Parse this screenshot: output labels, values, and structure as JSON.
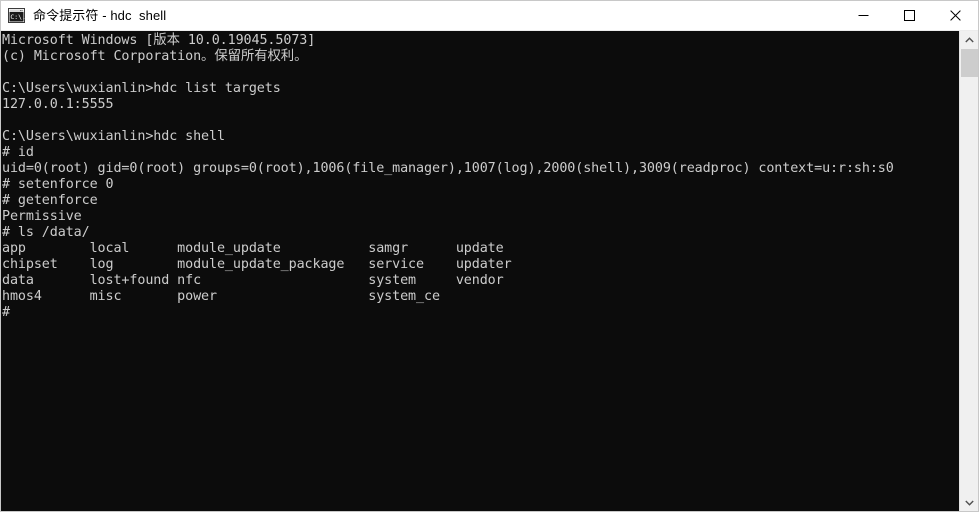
{
  "window": {
    "title": "命令提示符 - hdc  shell",
    "icon": "cmd-console-icon",
    "colors": {
      "titlebar_bg": "#ffffff",
      "titlebar_fg": "#000000",
      "console_bg": "#0c0c0c",
      "console_fg": "#cccccc",
      "scrollbar_track": "#f0f0f0",
      "scrollbar_thumb": "#cdcdcd"
    },
    "controls": {
      "minimize": "minimize-icon",
      "maximize": "maximize-icon",
      "close": "close-icon"
    }
  },
  "scrollbar": {
    "up_arrow": "chevron-up-icon",
    "down_arrow": "chevron-down-icon",
    "thumb_position_percent": 0,
    "thumb_size_percent": 6
  },
  "terminal": {
    "lines": [
      "Microsoft Windows [版本 10.0.19045.5073]",
      "(c) Microsoft Corporation。保留所有权利。",
      "",
      "C:\\Users\\wuxianlin>hdc list targets",
      "127.0.0.1:5555",
      "",
      "C:\\Users\\wuxianlin>hdc shell",
      "# id",
      "uid=0(root) gid=0(root) groups=0(root),1006(file_manager),1007(log),2000(shell),3009(readproc) context=u:r:sh:s0",
      "# setenforce 0",
      "# getenforce",
      "Permissive",
      "# ls /data/",
      "app        local      module_update           samgr      update",
      "chipset    log        module_update_package   service    updater",
      "data       lost+found nfc                     system     vendor",
      "hmos4      misc       power                   system_ce",
      "#"
    ]
  }
}
